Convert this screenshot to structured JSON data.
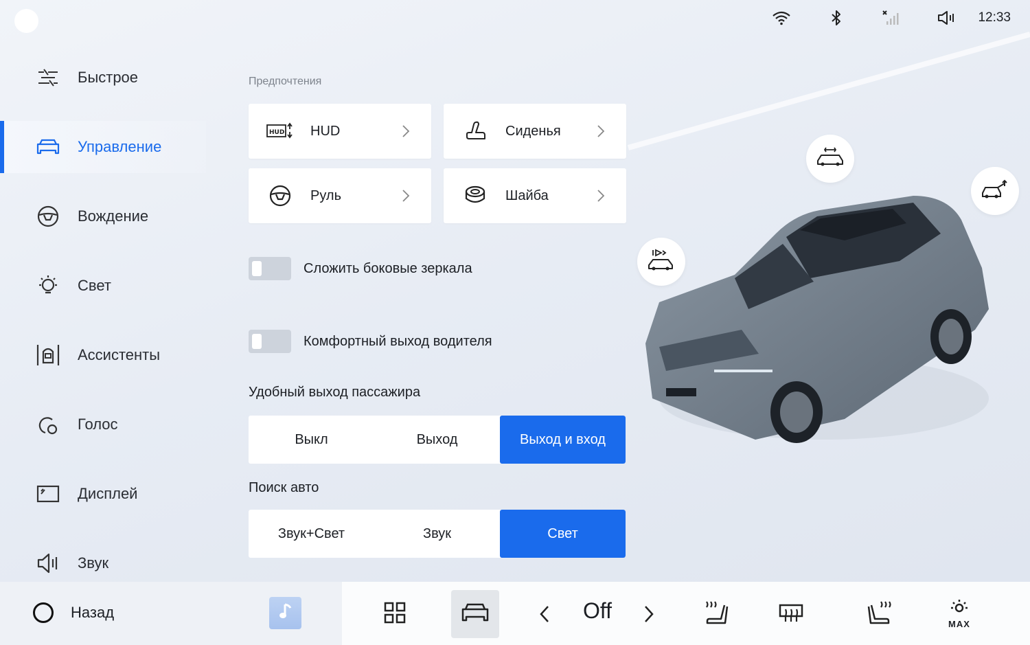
{
  "status": {
    "time": "12:33",
    "icons": [
      "wifi-icon",
      "bluetooth-icon",
      "no-signal-icon",
      "volume-icon"
    ]
  },
  "sidebar": {
    "items": [
      {
        "label": "Быстрое",
        "icon": "sliders-icon",
        "active": false
      },
      {
        "label": "Управление",
        "icon": "car-control-icon",
        "active": true
      },
      {
        "label": "Вождение",
        "icon": "steering-wheel-icon",
        "active": false
      },
      {
        "label": "Свет",
        "icon": "light-bulb-icon",
        "active": false
      },
      {
        "label": "Ассистенты",
        "icon": "assist-icon",
        "active": false
      },
      {
        "label": "Голос",
        "icon": "voice-icon",
        "active": false
      },
      {
        "label": "Дисплей",
        "icon": "display-icon",
        "active": false
      },
      {
        "label": "Звук",
        "icon": "speaker-icon",
        "active": false
      }
    ]
  },
  "main": {
    "section_title": "Предпочтения",
    "cards": [
      {
        "label": "HUD",
        "icon": "hud-icon"
      },
      {
        "label": "Сиденья",
        "icon": "seat-icon"
      },
      {
        "label": "Руль",
        "icon": "steering-wheel-icon"
      },
      {
        "label": "Шайба",
        "icon": "puck-icon"
      }
    ],
    "toggles": [
      {
        "label": "Сложить боковые зеркала",
        "on": false
      },
      {
        "label": "Комфортный выход водителя",
        "on": false
      }
    ],
    "passenger_exit": {
      "label": "Удобный выход пассажира",
      "options": [
        "Выкл",
        "Выход",
        "Выход и вход"
      ],
      "selected": "Выход и вход"
    },
    "find_car": {
      "label": "Поиск авто",
      "options": [
        "Звук+Свет",
        "Звук",
        "Свет"
      ],
      "selected": "Свет"
    }
  },
  "car_buttons": [
    "sunroof-icon",
    "trunk-icon",
    "lights-flash-icon"
  ],
  "dock": {
    "back_label": "Назад",
    "fan_value": "Off",
    "max_label": "MAX",
    "accent_color": "#1a6bec"
  }
}
